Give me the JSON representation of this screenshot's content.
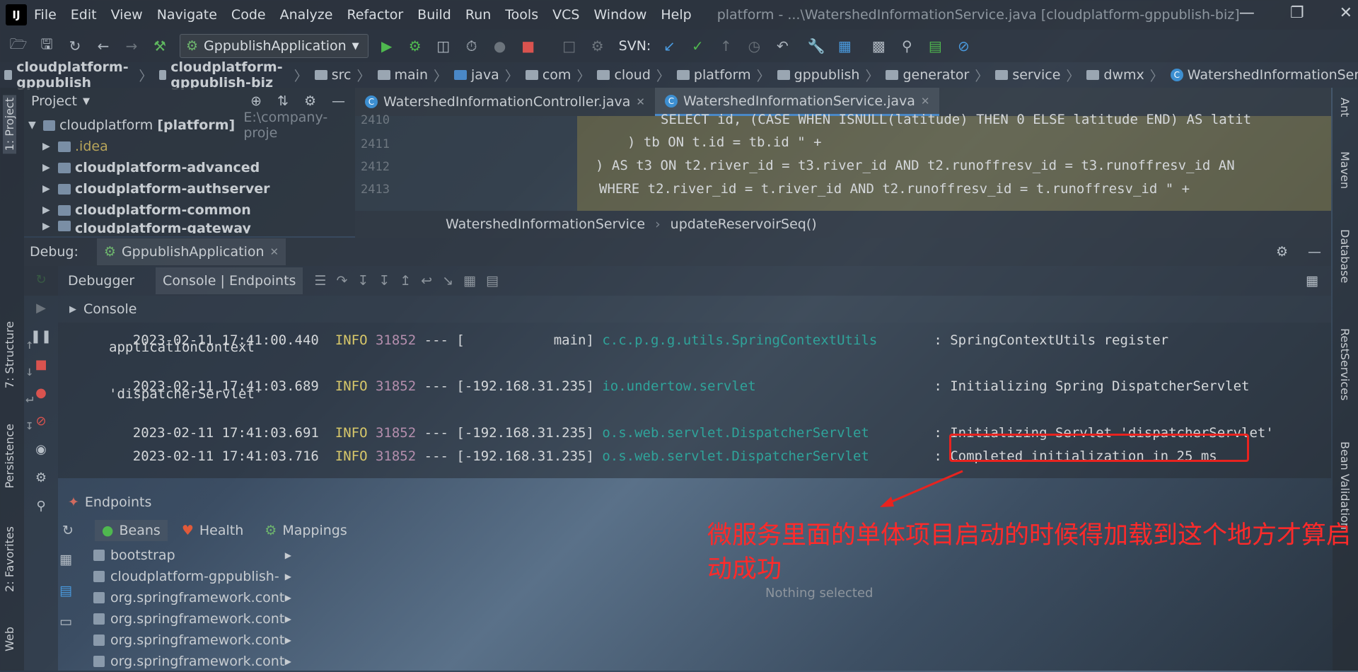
{
  "menubar": {
    "logo": "IJ",
    "items": [
      "File",
      "Edit",
      "View",
      "Navigate",
      "Code",
      "Analyze",
      "Refactor",
      "Build",
      "Run",
      "Tools",
      "VCS",
      "Window",
      "Help"
    ],
    "title": "platform - ...\\WatershedInformationService.java [cloudplatform-gppublish-biz]"
  },
  "toolbar": {
    "run_config": "GppublishApplication",
    "svn_label": "SVN:"
  },
  "breadcrumb": [
    "cloudplatform-gppublish",
    "cloudplatform-gppublish-biz",
    "src",
    "main",
    "java",
    "com",
    "cloud",
    "platform",
    "gppublish",
    "generator",
    "service",
    "dwmx",
    "WatershedInformationService"
  ],
  "sidebar": {
    "left_tabs": [
      "1: Project",
      "7: Structure",
      "Persistence",
      "2: Favorites",
      "Web"
    ],
    "right_tabs": [
      "Ant",
      "Maven",
      "Database",
      "RestServices",
      "Bean Validation"
    ]
  },
  "project": {
    "title": "Project",
    "root": {
      "name": "cloudplatform",
      "tag": "[platform]",
      "path": "E:\\company-proje"
    },
    "items": [
      ".idea",
      "cloudplatform-advanced",
      "cloudplatform-authserver",
      "cloudplatform-common",
      "cloudplatform-gateway"
    ]
  },
  "editor": {
    "tabs": [
      "WatershedInformationController.java",
      "WatershedInformationService.java"
    ],
    "lines": [
      {
        "num": "2410",
        "code": "SELECT id, (CASE WHEN ISNULL(latitude) THEN 0 ELSE latitude END) AS latit"
      },
      {
        "num": "2411",
        "code": ") tb ON t.id = tb.id \" +"
      },
      {
        "num": "2412",
        "code": ") AS t3 ON t2.river_id = t3.river_id AND t2.runoffresv_id = t3.runoffresv_id AN"
      },
      {
        "num": "2413",
        "code": "WHERE t2.river_id = t.river_id AND t2.runoffresv_id = t.runoffresv_id \" +"
      }
    ],
    "crumb_class": "WatershedInformationService",
    "crumb_method": "updateReservoirSeq()"
  },
  "debug": {
    "label": "Debug:",
    "app": "GppublishApplication",
    "tabs": [
      "Debugger",
      "Console | Endpoints"
    ],
    "console_label": "Console"
  },
  "console": {
    "lines": [
      {
        "ts": "2023-02-11 17:41:00.440",
        "level": "INFO",
        "pid": "31852",
        "sep": "---",
        "thread": "[           main]",
        "logger": "c.c.p.g.g.utils.SpringContextUtils",
        "msg": ": SpringContextUtils register",
        "cont": "applicationContext"
      },
      {
        "ts": "2023-02-11 17:41:03.689",
        "level": "INFO",
        "pid": "31852",
        "sep": "---",
        "thread": "[-192.168.31.235]",
        "logger": "io.undertow.servlet",
        "msg": ": Initializing Spring DispatcherServlet",
        "cont": "'dispatcherServlet'"
      },
      {
        "ts": "2023-02-11 17:41:03.691",
        "level": "INFO",
        "pid": "31852",
        "sep": "---",
        "thread": "[-192.168.31.235]",
        "logger": "o.s.web.servlet.DispatcherServlet",
        "msg": ": Initializing Servlet 'dispatcherServlet'",
        "cont": ""
      },
      {
        "ts": "2023-02-11 17:41:03.716",
        "level": "INFO",
        "pid": "31852",
        "sep": "---",
        "thread": "[-192.168.31.235]",
        "logger": "o.s.web.servlet.DispatcherServlet",
        "msg": ": Completed initialization in 25 ms",
        "cont": ""
      }
    ]
  },
  "endpoints": {
    "label": "Endpoints",
    "tabs": [
      "Beans",
      "Health",
      "Mappings"
    ],
    "beans": [
      "bootstrap",
      "cloudplatform-gppublish-",
      "org.springframework.cont",
      "org.springframework.cont",
      "org.springframework.cont",
      "org.springframework.cont"
    ],
    "nothing_selected": "Nothing selected"
  },
  "annotation": "微服务里面的单体项目启动的时候得加载到这个地方才算启动成功"
}
